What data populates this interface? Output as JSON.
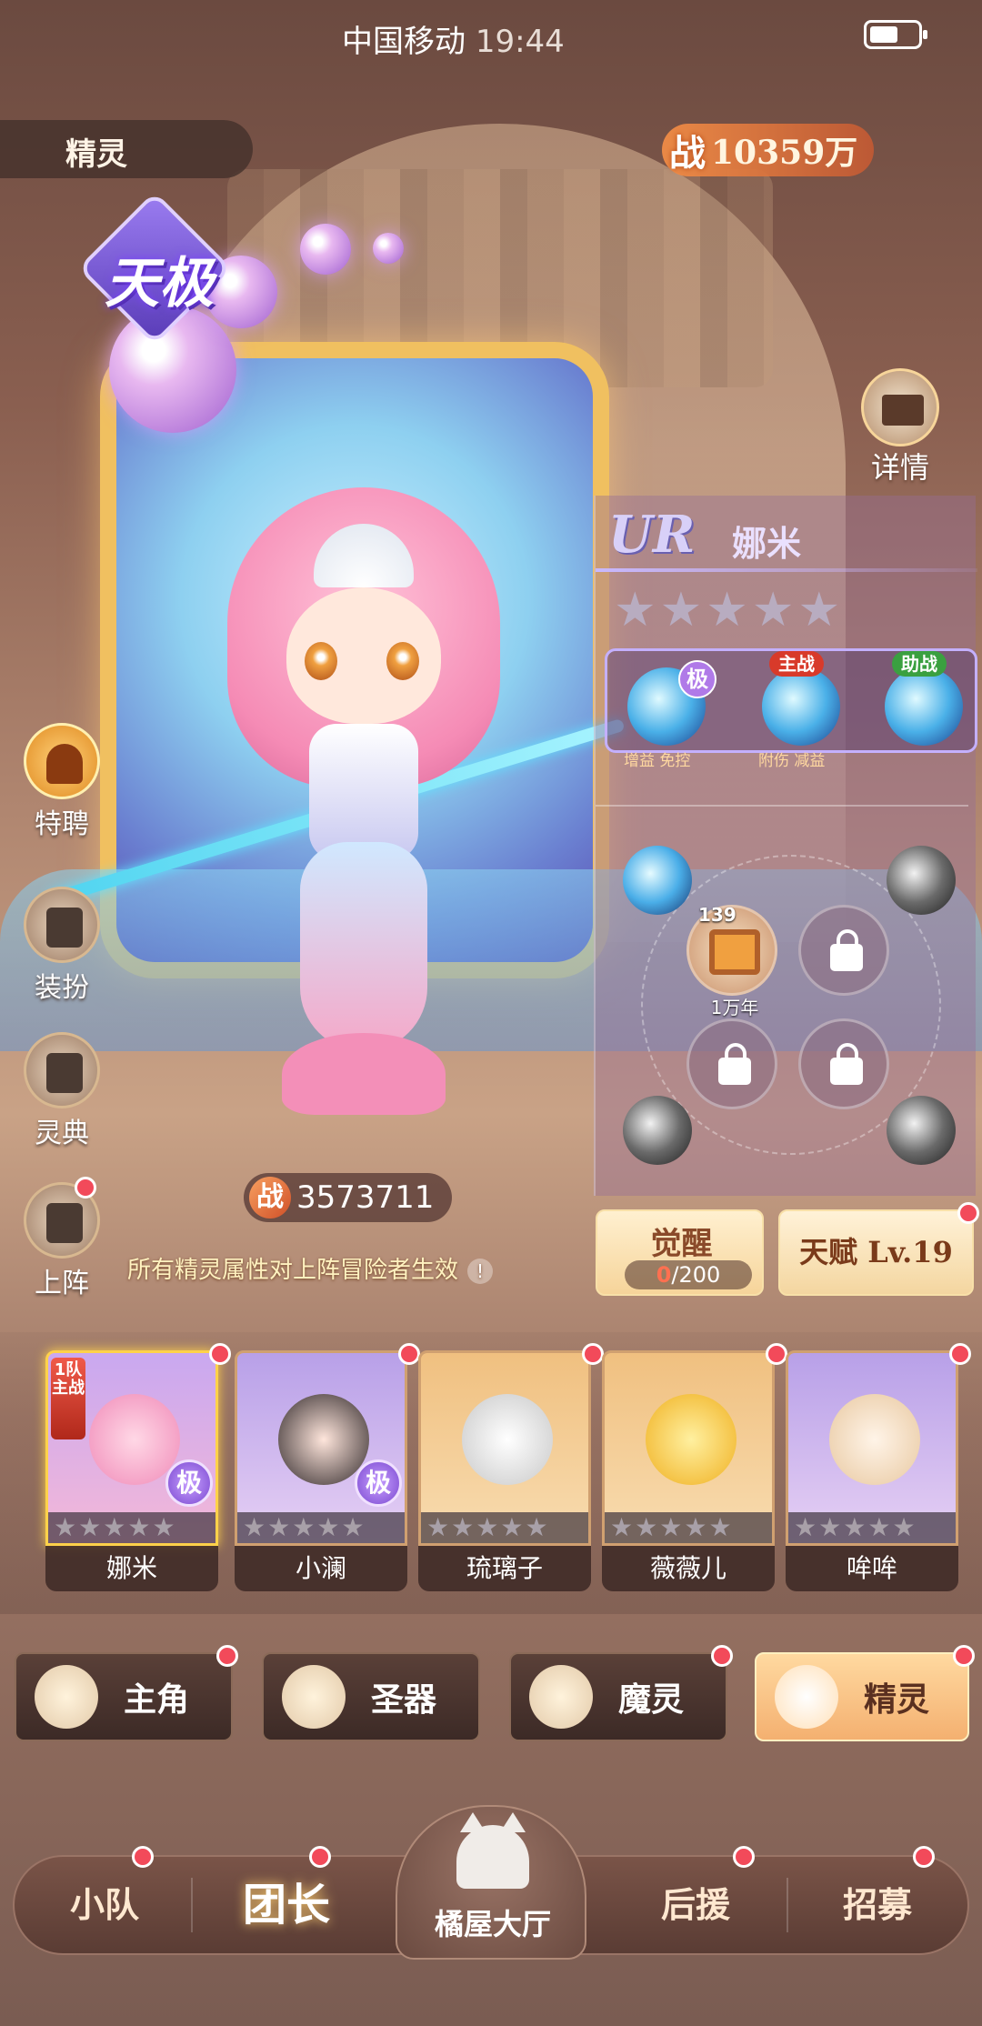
{
  "status_bar": {
    "carrier": "中国移动",
    "time": "19:44"
  },
  "header": {
    "section_title": "精灵",
    "total_power_label": "战",
    "total_power_value": "10359万"
  },
  "tier_badge": "天极",
  "detail_button": "详情",
  "side_buttons": [
    {
      "label": "特聘",
      "icon": "special-recruit-icon"
    },
    {
      "label": "装扮",
      "icon": "chat-bubble-icon"
    },
    {
      "label": "灵典",
      "icon": "book-icon"
    },
    {
      "label": "上阵",
      "icon": "deploy-icon"
    }
  ],
  "spirit_panel": {
    "rarity": "UR",
    "name": "娜米",
    "stars": 5,
    "skills": [
      {
        "badge": "极",
        "sub": "增益  免控"
      },
      {
        "tag": "主战",
        "sub": "附伤  减益"
      },
      {
        "tag": "助战"
      }
    ],
    "talent_slot": {
      "level": "139",
      "years": "1万年"
    }
  },
  "spirit_power": {
    "label": "战",
    "value": "3573711"
  },
  "description": "所有精灵属性对上阵冒险者生效",
  "awaken": {
    "label": "觉醒",
    "progress_current": "0",
    "progress_total": "/200"
  },
  "talent": {
    "label": "天赋 Lv.19"
  },
  "roster": [
    {
      "name": "娜米",
      "team_tag": "1队主战",
      "ji": "极",
      "selected": true
    },
    {
      "name": "小澜",
      "ji": "极"
    },
    {
      "name": "琉璃子"
    },
    {
      "name": "薇薇儿"
    },
    {
      "name": "哞哞"
    }
  ],
  "categories": [
    {
      "label": "主角",
      "icon": "hero-icon"
    },
    {
      "label": "圣器",
      "icon": "artifact-icon"
    },
    {
      "label": "魔灵",
      "icon": "dragon-icon"
    },
    {
      "label": "精灵",
      "icon": "spirit-icon",
      "active": true
    }
  ],
  "bottom_nav": {
    "squad": "小队",
    "leader": "团长",
    "hall": "橘屋大厅",
    "support": "后援",
    "recruit": "招募"
  },
  "colors": {
    "accent_gold": "#ffd24a",
    "red_dot": "#f24a5a",
    "panel_purple": "#c4b0ff"
  }
}
